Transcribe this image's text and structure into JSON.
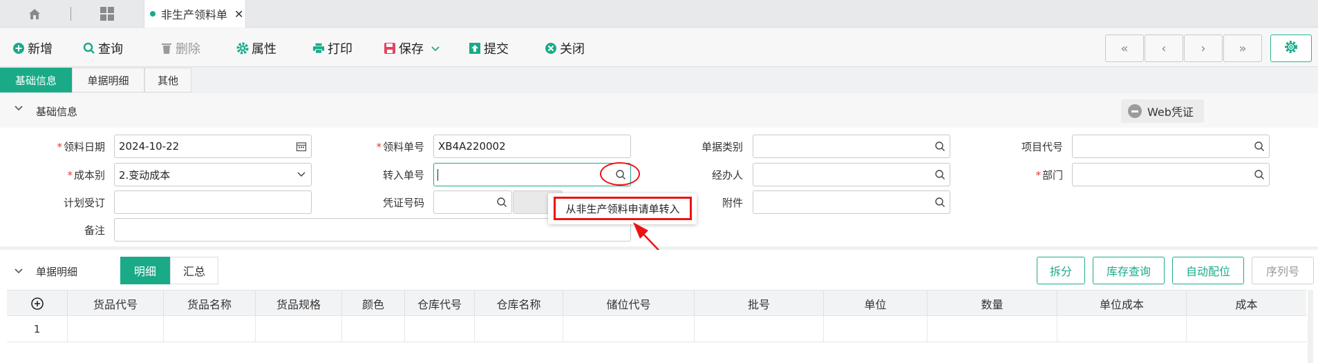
{
  "tabbar": {
    "doc_tab_label": "非生产领料单",
    "icons": [
      "home-icon",
      "apps-grid-icon",
      "close-icon"
    ]
  },
  "toolbar": {
    "new": "新增",
    "query": "查询",
    "delete": "删除",
    "properties": "属性",
    "print": "打印",
    "save": "保存",
    "submit": "提交",
    "close": "关闭",
    "nav": [
      "«",
      "‹",
      "›",
      "»"
    ]
  },
  "form_tabs": [
    "基础信息",
    "单据明细",
    "其他"
  ],
  "basic_section": {
    "title": "基础信息",
    "web_voucher": "Web凭证",
    "fields": {
      "issue_date_label": "领料日期",
      "issue_date_value": "2024-10-22",
      "issue_no_label": "领料单号",
      "issue_no_value": "XB4A220002",
      "doc_type_label": "单据类别",
      "project_code_label": "项目代号",
      "cost_type_label": "成本别",
      "cost_type_value": "2.变动成本",
      "transfer_no_label": "转入单号",
      "handler_label": "经办人",
      "department_label": "部门",
      "plan_order_label": "计划受订",
      "voucher_no_label": "凭证号码",
      "attachment_label": "附件",
      "remark_label": "备注"
    },
    "tooltip": "从非生产领料申请单转入"
  },
  "detail_section": {
    "title": "单据明细",
    "tabs": [
      "明细",
      "汇总"
    ],
    "buttons": [
      "拆分",
      "库存查询",
      "自动配位",
      "序列号"
    ],
    "columns": [
      "货品代号",
      "货品名称",
      "货品规格",
      "颜色",
      "仓库代号",
      "仓库名称",
      "储位代号",
      "批号",
      "单位",
      "数量",
      "单位成本",
      "成本"
    ],
    "rows": [
      {
        "index": "1"
      }
    ]
  },
  "colors": {
    "accent": "#1aaa88",
    "highlight": "#e11111",
    "required": "#e53935"
  }
}
